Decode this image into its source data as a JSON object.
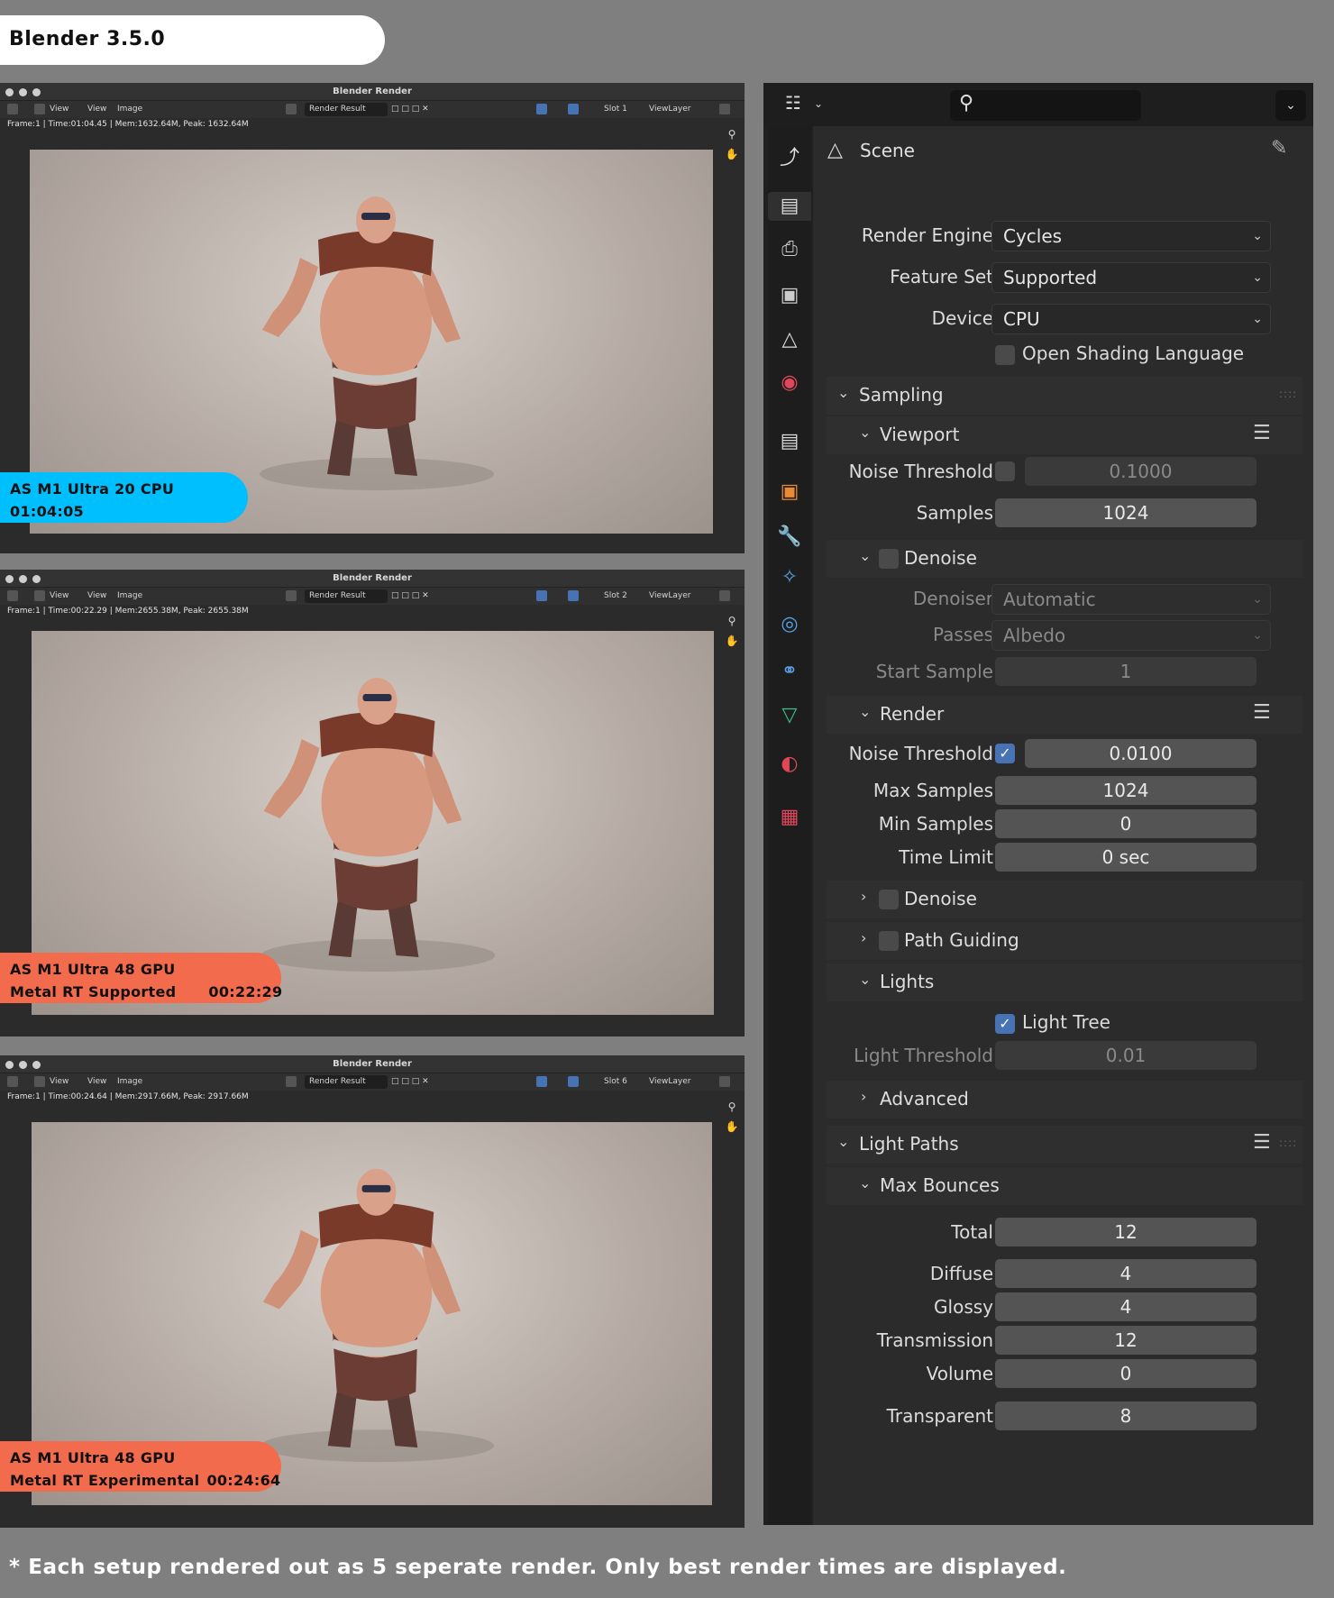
{
  "app_title": "Blender 3.5.0",
  "render_windows": [
    {
      "title": "Blender Render",
      "menu": [
        "View",
        "View",
        "Image"
      ],
      "image_name": "Render Result",
      "slot": "Slot 1",
      "view_layer": "ViewLayer",
      "info": "Frame:1 | Time:01:04.45 | Mem:1632.64M, Peak: 1632.64M",
      "badge_line1": "AS M1 Ultra 20 CPU",
      "badge_line2": "01:04:05",
      "badge_time": "",
      "badge_color": "#00bfff"
    },
    {
      "title": "Blender Render",
      "menu": [
        "View",
        "View",
        "Image"
      ],
      "image_name": "Render Result",
      "slot": "Slot 2",
      "view_layer": "ViewLayer",
      "info": "Frame:1 | Time:00:22.29 | Mem:2655.38M, Peak: 2655.38M",
      "badge_line1": "AS M1 Ultra 48 GPU",
      "badge_line2": "Metal RT Supported",
      "badge_time": "00:22:29",
      "badge_color": "#f26b4c"
    },
    {
      "title": "Blender Render",
      "menu": [
        "View",
        "View",
        "Image"
      ],
      "image_name": "Render Result",
      "slot": "Slot 6",
      "view_layer": "ViewLayer",
      "info": "Frame:1 | Time:00:24.64 | Mem:2917.66M, Peak: 2917.66M",
      "badge_line1": "AS M1 Ultra 48 GPU",
      "badge_line2": "Metal RT Experimental",
      "badge_time": "00:24:64",
      "badge_color": "#f26b4c"
    }
  ],
  "properties": {
    "context": "Scene",
    "tabs": [
      "tool-icon",
      "render-icon",
      "output-icon",
      "view-layer-icon",
      "scene-icon",
      "world-icon",
      "collection-icon",
      "object-icon",
      "modifier-icon",
      "particles-icon",
      "physics-icon",
      "constraints-icon",
      "data-icon",
      "material-icon",
      "texture-icon"
    ],
    "render_engine_label": "Render Engine",
    "render_engine": "Cycles",
    "feature_set_label": "Feature Set",
    "feature_set": "Supported",
    "device_label": "Device",
    "device": "CPU",
    "osl_label": "Open Shading Language",
    "sampling": {
      "title": "Sampling",
      "viewport": {
        "title": "Viewport",
        "noise_threshold_label": "Noise Threshold",
        "noise_threshold": "0.1000",
        "noise_threshold_enabled": false,
        "samples_label": "Samples",
        "samples": "1024",
        "denoise_label": "Denoise",
        "denoiser_label": "Denoiser",
        "denoiser": "Automatic",
        "passes_label": "Passes",
        "passes": "Albedo",
        "start_sample_label": "Start Sample",
        "start_sample": "1"
      },
      "render": {
        "title": "Render",
        "noise_threshold_label": "Noise Threshold",
        "noise_threshold": "0.0100",
        "noise_threshold_enabled": true,
        "max_samples_label": "Max Samples",
        "max_samples": "1024",
        "min_samples_label": "Min Samples",
        "min_samples": "0",
        "time_limit_label": "Time Limit",
        "time_limit": "0 sec"
      },
      "denoise_label": "Denoise",
      "path_guiding_label": "Path Guiding",
      "lights": {
        "title": "Lights",
        "light_tree_label": "Light Tree",
        "light_tree_enabled": true,
        "light_threshold_label": "Light Threshold",
        "light_threshold": "0.01"
      },
      "advanced_label": "Advanced"
    },
    "light_paths": {
      "title": "Light Paths",
      "max_bounces": {
        "title": "Max Bounces",
        "total_label": "Total",
        "total": "12",
        "diffuse_label": "Diffuse",
        "diffuse": "4",
        "glossy_label": "Glossy",
        "glossy": "4",
        "transmission_label": "Transmission",
        "transmission": "12",
        "volume_label": "Volume",
        "volume": "0",
        "transparent_label": "Transparent",
        "transparent": "8"
      }
    }
  },
  "footnote": "* Each setup rendered out as 5 seperate render. Only best render times are displayed."
}
